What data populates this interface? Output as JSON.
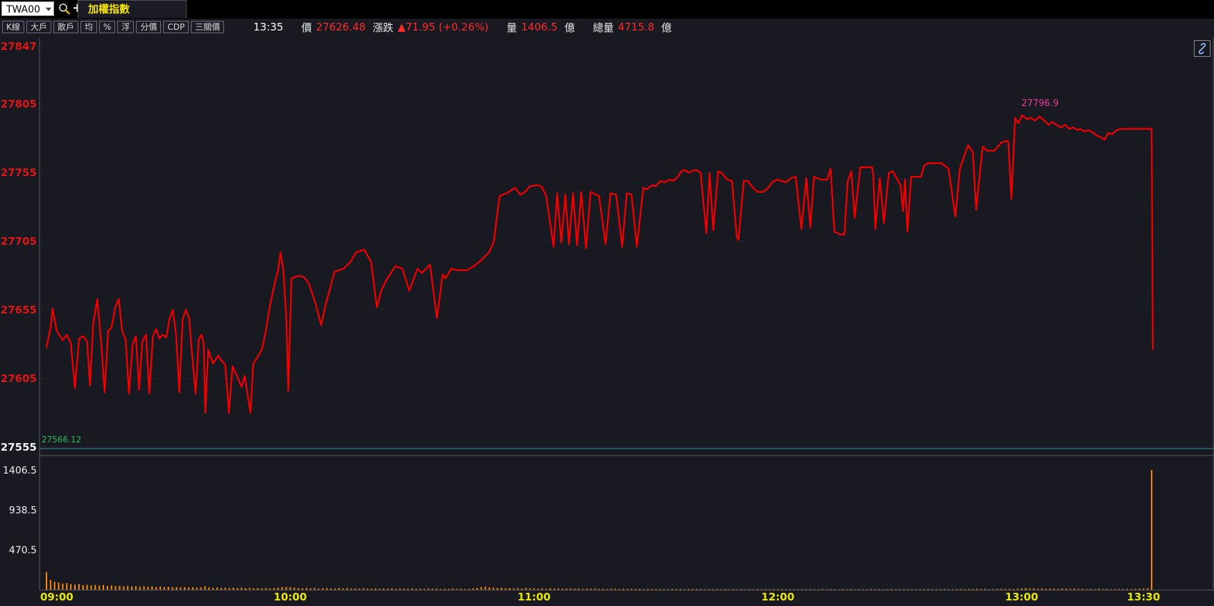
{
  "toolbar": {
    "symbol_value": "TWA00",
    "plus_label": "+",
    "tab_label": "加權指數",
    "buttons": [
      "K線",
      "大戶",
      "散戶",
      "均",
      "%",
      "浮",
      "分價",
      "CDP",
      "三關價"
    ]
  },
  "status": {
    "time": "13:35",
    "price_label": "價",
    "price": "27626.48",
    "change_label": "漲跌",
    "change": "▲71.95 (+0.26%)",
    "volume_label": "量",
    "volume": "1406.5",
    "volume_unit": "億",
    "total_label": "總量",
    "total": "4715.8",
    "total_unit": "億"
  },
  "colors": {
    "background": "#191922",
    "topbar": "#000000",
    "line": "#f20000",
    "volume_bar": "#ff8a00",
    "grid": "#23232e",
    "border": "#5a5a64",
    "separator": "#2d6f7a",
    "axis_red": "#e01616",
    "axis_white": "#f0f0f0",
    "time_yellow": "#e8e800",
    "high_label": "#e83898",
    "low_label": "#2fbf5f",
    "tab_yellow": "#f5e400",
    "status_red": "#ff2a2a"
  },
  "chart_data": {
    "type": "line",
    "title": "加權指數",
    "legend_position": "none",
    "grid": "horizontal-faint",
    "x_axis": {
      "labels": [
        "09:00",
        "10:00",
        "11:00",
        "12:00",
        "13:00",
        "13:30"
      ],
      "minutes": [
        0,
        60,
        120,
        180,
        240,
        270
      ]
    },
    "price_axis": {
      "ticks": [
        27847,
        27805,
        27755,
        27705,
        27655,
        27605,
        27555
      ],
      "range": [
        27555,
        27847
      ]
    },
    "volume_axis": {
      "ticks": [
        1406.5,
        938.5,
        470.5
      ],
      "range": [
        0,
        1462
      ]
    },
    "high_label": {
      "text": "27796.9",
      "price": 27796.9,
      "t": 240.1
    },
    "low_label": {
      "text": "27566.12",
      "price": 27566.12
    },
    "price_series": [
      [
        0,
        27628
      ],
      [
        1,
        27642
      ],
      [
        1.5,
        27656
      ],
      [
        2.5,
        27640
      ],
      [
        4,
        27633
      ],
      [
        5,
        27637
      ],
      [
        6,
        27631
      ],
      [
        7,
        27598
      ],
      [
        8,
        27634
      ],
      [
        9,
        27636
      ],
      [
        10,
        27632
      ],
      [
        10.7,
        27600
      ],
      [
        11.5,
        27645
      ],
      [
        12.5,
        27663
      ],
      [
        13.5,
        27630
      ],
      [
        14.3,
        27595
      ],
      [
        15.2,
        27640
      ],
      [
        16,
        27642
      ],
      [
        17,
        27658
      ],
      [
        17.8,
        27663
      ],
      [
        18.6,
        27640
      ],
      [
        19.5,
        27633
      ],
      [
        20.3,
        27594
      ],
      [
        21.2,
        27630
      ],
      [
        22,
        27636
      ],
      [
        22.8,
        27597
      ],
      [
        23.6,
        27632
      ],
      [
        24.5,
        27637
      ],
      [
        25.3,
        27594
      ],
      [
        26.2,
        27636
      ],
      [
        27,
        27641
      ],
      [
        27.8,
        27634
      ],
      [
        28.6,
        27637
      ],
      [
        29.5,
        27635
      ],
      [
        30.3,
        27649
      ],
      [
        31.1,
        27655
      ],
      [
        31.9,
        27637
      ],
      [
        32.7,
        27595
      ],
      [
        33.5,
        27648
      ],
      [
        34.3,
        27655
      ],
      [
        35.1,
        27649
      ],
      [
        35.9,
        27620
      ],
      [
        36.7,
        27594
      ],
      [
        37.5,
        27634
      ],
      [
        38.2,
        27637
      ],
      [
        38.7,
        27630
      ],
      [
        39.1,
        27580
      ],
      [
        39.8,
        27626
      ],
      [
        41,
        27616
      ],
      [
        42.3,
        27622
      ],
      [
        43.1,
        27618
      ],
      [
        44,
        27615
      ],
      [
        44.9,
        27580
      ],
      [
        45.8,
        27614
      ],
      [
        47,
        27606
      ],
      [
        48,
        27599
      ],
      [
        48.8,
        27607
      ],
      [
        50.2,
        27580
      ],
      [
        50.9,
        27616
      ],
      [
        52,
        27621
      ],
      [
        53,
        27626
      ],
      [
        54,
        27640
      ],
      [
        55,
        27658
      ],
      [
        56,
        27672
      ],
      [
        57,
        27684
      ],
      [
        57.6,
        27697
      ],
      [
        58.3,
        27684
      ],
      [
        59,
        27650
      ],
      [
        59.5,
        27596
      ],
      [
        60.3,
        27678
      ],
      [
        62,
        27680
      ],
      [
        63.4,
        27679
      ],
      [
        64.6,
        27674
      ],
      [
        66.2,
        27660
      ],
      [
        67.6,
        27644
      ],
      [
        68.8,
        27660
      ],
      [
        70.9,
        27683
      ],
      [
        73.1,
        27685
      ],
      [
        74.8,
        27690
      ],
      [
        76.2,
        27697
      ],
      [
        78.2,
        27699
      ],
      [
        79.9,
        27690
      ],
      [
        81.3,
        27657
      ],
      [
        82.5,
        27670
      ],
      [
        83.7,
        27677
      ],
      [
        85.9,
        27687
      ],
      [
        87.6,
        27685
      ],
      [
        89.3,
        27669
      ],
      [
        91.3,
        27685
      ],
      [
        92.4,
        27682
      ],
      [
        94.4,
        27688
      ],
      [
        96.1,
        27649
      ],
      [
        97.5,
        27681
      ],
      [
        98.2,
        27678
      ],
      [
        99.6,
        27685
      ],
      [
        101.3,
        27684
      ],
      [
        103.5,
        27684
      ],
      [
        105.2,
        27687
      ],
      [
        106.9,
        27691
      ],
      [
        108.9,
        27697
      ],
      [
        110.1,
        27705
      ],
      [
        111.5,
        27738
      ],
      [
        113.2,
        27740
      ],
      [
        115.3,
        27744
      ],
      [
        116.6,
        27739
      ],
      [
        117.8,
        27741
      ],
      [
        118.9,
        27745
      ],
      [
        120.6,
        27746
      ],
      [
        121.8,
        27745
      ],
      [
        123,
        27738
      ],
      [
        124.8,
        27701
      ],
      [
        125.7,
        27740
      ],
      [
        126.7,
        27704
      ],
      [
        127.7,
        27739
      ],
      [
        128.6,
        27703
      ],
      [
        129.6,
        27740
      ],
      [
        130.6,
        27702
      ],
      [
        131.6,
        27741
      ],
      [
        132.8,
        27700
      ],
      [
        133.9,
        27741
      ],
      [
        134.6,
        27740
      ],
      [
        136,
        27738
      ],
      [
        137.6,
        27703
      ],
      [
        138.8,
        27740
      ],
      [
        140.2,
        27739
      ],
      [
        141.7,
        27701
      ],
      [
        142.8,
        27740
      ],
      [
        144,
        27739
      ],
      [
        145.3,
        27701
      ],
      [
        146.9,
        27744
      ],
      [
        147.7,
        27743
      ],
      [
        149.1,
        27746
      ],
      [
        149.9,
        27745
      ],
      [
        151.1,
        27749
      ],
      [
        152.2,
        27748
      ],
      [
        153.3,
        27750
      ],
      [
        154.2,
        27749
      ],
      [
        155.4,
        27752
      ],
      [
        156.2,
        27756
      ],
      [
        157.1,
        27757
      ],
      [
        158,
        27755
      ],
      [
        158.8,
        27756
      ],
      [
        159.7,
        27757
      ],
      [
        160.5,
        27756
      ],
      [
        161,
        27755
      ],
      [
        162.4,
        27711
      ],
      [
        163.2,
        27755
      ],
      [
        164.1,
        27713
      ],
      [
        165.3,
        27756
      ],
      [
        166.1,
        27755
      ],
      [
        167.5,
        27750
      ],
      [
        168.7,
        27749
      ],
      [
        169.9,
        27708
      ],
      [
        170.3,
        27706
      ],
      [
        171.6,
        27749
      ],
      [
        172.6,
        27749
      ],
      [
        173.9,
        27744
      ],
      [
        175,
        27741
      ],
      [
        176.4,
        27741
      ],
      [
        177.6,
        27744
      ],
      [
        178.6,
        27748
      ],
      [
        179.8,
        27750
      ],
      [
        181,
        27749
      ],
      [
        182,
        27748
      ],
      [
        183.2,
        27751
      ],
      [
        184.4,
        27752
      ],
      [
        185.8,
        27714
      ],
      [
        187,
        27751
      ],
      [
        188,
        27715
      ],
      [
        188.9,
        27752
      ],
      [
        190.5,
        27750
      ],
      [
        192.1,
        27750
      ],
      [
        193,
        27758
      ],
      [
        193.9,
        27712
      ],
      [
        195.4,
        27710
      ],
      [
        196.4,
        27710
      ],
      [
        197.2,
        27749
      ],
      [
        198.1,
        27756
      ],
      [
        198.9,
        27722
      ],
      [
        200.3,
        27759
      ],
      [
        202,
        27759
      ],
      [
        203.2,
        27759
      ],
      [
        203.5,
        27753
      ],
      [
        204,
        27714
      ],
      [
        205.1,
        27751
      ],
      [
        206.1,
        27718
      ],
      [
        207.3,
        27755
      ],
      [
        208.3,
        27756
      ],
      [
        210.2,
        27746
      ],
      [
        210.8,
        27727
      ],
      [
        211.3,
        27750
      ],
      [
        211.9,
        27712
      ],
      [
        212.8,
        27752
      ],
      [
        214,
        27752
      ],
      [
        215.2,
        27752
      ],
      [
        216,
        27760
      ],
      [
        216.9,
        27762
      ],
      [
        218.5,
        27762
      ],
      [
        220.3,
        27762
      ],
      [
        222,
        27758
      ],
      [
        223.7,
        27723
      ],
      [
        224.8,
        27758
      ],
      [
        226.8,
        27775
      ],
      [
        228,
        27770
      ],
      [
        228.8,
        27728
      ],
      [
        230.4,
        27774
      ],
      [
        231.5,
        27771
      ],
      [
        233.3,
        27771
      ],
      [
        235,
        27777
      ],
      [
        236,
        27778
      ],
      [
        236.7,
        27778
      ],
      [
        237.5,
        27736
      ],
      [
        238.4,
        27795
      ],
      [
        239.2,
        27791
      ],
      [
        240.1,
        27796.9
      ],
      [
        241.3,
        27794
      ],
      [
        242.3,
        27795
      ],
      [
        243.3,
        27793
      ],
      [
        244.4,
        27796
      ],
      [
        245.2,
        27794
      ],
      [
        246.6,
        27790
      ],
      [
        247.6,
        27792
      ],
      [
        248.5,
        27790
      ],
      [
        249.7,
        27788
      ],
      [
        250.7,
        27790
      ],
      [
        251.7,
        27787
      ],
      [
        252.7,
        27788
      ],
      [
        253.8,
        27786
      ],
      [
        254.4,
        27787
      ],
      [
        255.5,
        27785
      ],
      [
        256.5,
        27786
      ],
      [
        257.7,
        27784
      ],
      [
        258.5,
        27782
      ],
      [
        259.4,
        27781
      ],
      [
        260.4,
        27779
      ],
      [
        261.3,
        27784
      ],
      [
        262.3,
        27783
      ],
      [
        263.3,
        27786
      ],
      [
        264.7,
        27787
      ],
      [
        272,
        27787
      ],
      [
        272.3,
        27626.48
      ]
    ],
    "volume_series": [
      209,
      118,
      96,
      88,
      76,
      82,
      70,
      64,
      72,
      58,
      62,
      55,
      60,
      52,
      58,
      48,
      54,
      46,
      50,
      44,
      48,
      42,
      46,
      40,
      44,
      38,
      42,
      36,
      40,
      34,
      38,
      33,
      36,
      31,
      34,
      30,
      33,
      29,
      32,
      45,
      31,
      27,
      30,
      26,
      29,
      25,
      28,
      24,
      27,
      23,
      26,
      22,
      25,
      21,
      24,
      20,
      23,
      28,
      32,
      36,
      34,
      28,
      24,
      22,
      26,
      20,
      24,
      18,
      22,
      26,
      20,
      18,
      24,
      20,
      22,
      18,
      20,
      16,
      22,
      18,
      16,
      20,
      15,
      18,
      16,
      20,
      14,
      18,
      16,
      15,
      18,
      14,
      16,
      13,
      17,
      14,
      16,
      12,
      15,
      14,
      18,
      13,
      16,
      12,
      15,
      20,
      26,
      34,
      40,
      32,
      28,
      24,
      26,
      22,
      24,
      20,
      22,
      18,
      24,
      20,
      22,
      18,
      20,
      16,
      22,
      18,
      20,
      15,
      18,
      20,
      16,
      18,
      14,
      18,
      16,
      18,
      14,
      16,
      12,
      16,
      14,
      12,
      16,
      13,
      15,
      12,
      14,
      11,
      14,
      12,
      14,
      11,
      13,
      10,
      14,
      11,
      13,
      10,
      12,
      14,
      11,
      13,
      10,
      12,
      11,
      12,
      10,
      13,
      10,
      12,
      9,
      12,
      10,
      11,
      9,
      12,
      10,
      11,
      9,
      11,
      10,
      12,
      9,
      11,
      10,
      9,
      12,
      10,
      11,
      9,
      10,
      12,
      9,
      11,
      10,
      9,
      11,
      10,
      12,
      9,
      11,
      10,
      9,
      12,
      10,
      11,
      9,
      10,
      12,
      9,
      11,
      10,
      12,
      10,
      9,
      11,
      10,
      12,
      9,
      11,
      10,
      12,
      9,
      10,
      11,
      12,
      10,
      14,
      12,
      16,
      12,
      14,
      10,
      12,
      14,
      16,
      12,
      14,
      12,
      16,
      20,
      24,
      18,
      22,
      16,
      20,
      14,
      18,
      16,
      14,
      18,
      16,
      14,
      16,
      14,
      16,
      12,
      14,
      12,
      16,
      12,
      14,
      10,
      12,
      14,
      12,
      14,
      12,
      14,
      16,
      18,
      22,
      1406.5,
      0
    ]
  }
}
